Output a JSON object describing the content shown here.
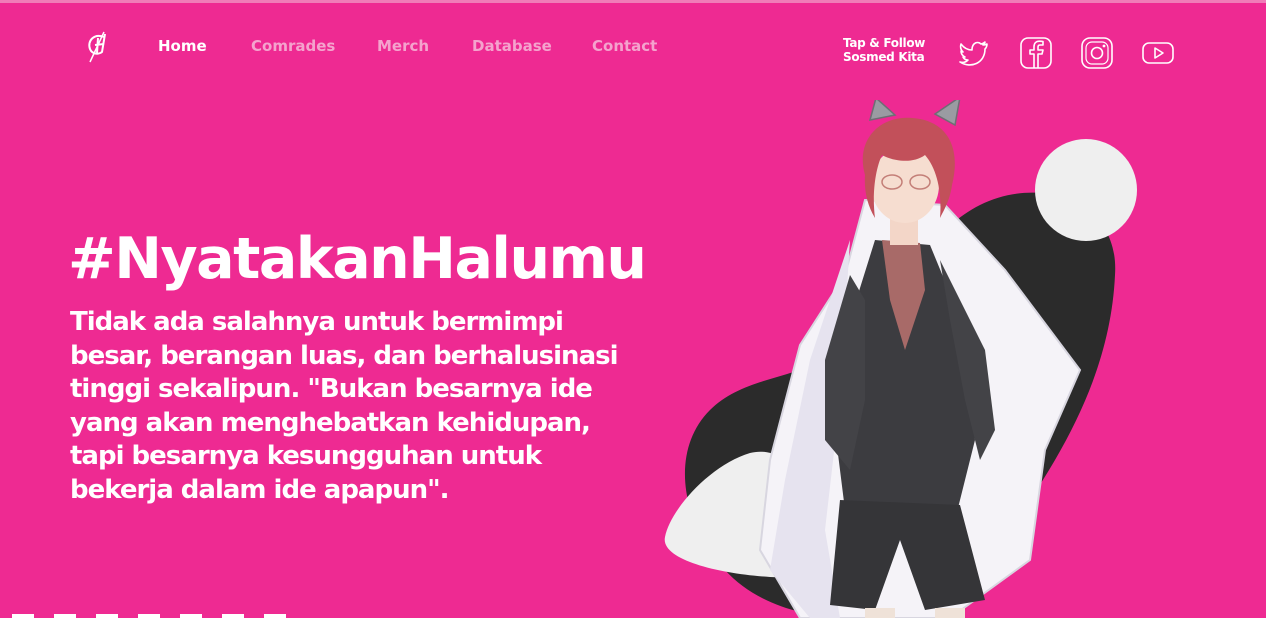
{
  "nav": {
    "items": [
      {
        "label": "Home",
        "active": true
      },
      {
        "label": "Comrades",
        "active": false
      },
      {
        "label": "Merch",
        "active": false
      },
      {
        "label": "Database",
        "active": false
      },
      {
        "label": "Contact",
        "active": false
      }
    ],
    "follow_line1": "Tap & Follow",
    "follow_line2": "Sosmed Kita",
    "social": [
      "twitter-icon",
      "facebook-icon",
      "instagram-icon",
      "youtube-icon"
    ]
  },
  "hero": {
    "title": "#NyatakanHalumu",
    "text": "Tidak ada salahnya untuk bermimpi besar, berangan luas, dan berhalusinasi tinggi sekalipun. \"Bukan besarnya ide yang akan menghebatkan kehidupan, tapi besarnya kesungguhan untuk bekerja dalam ide apapun\"."
  },
  "colors": {
    "brand": "#ee2a92",
    "menu_dim": "#f4a3cd",
    "blob_dark": "#2b2b2b",
    "blob_light": "#efefef"
  }
}
